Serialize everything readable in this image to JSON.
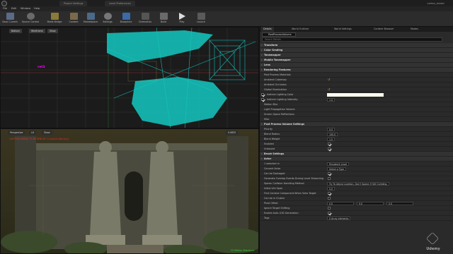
{
  "tabs": [
    {
      "label": "Project Settings"
    },
    {
      "label": "Level Preferences"
    }
  ],
  "project_name": "vertex_render",
  "menu": [
    "File",
    "Edit",
    "Window",
    "Help"
  ],
  "toolbar": [
    {
      "label": "Save Current",
      "icon": "save-icon"
    },
    {
      "label": "Source Control",
      "icon": "source-control-icon"
    },
    {
      "label": "Mode Bridge",
      "icon": "modes-icon"
    },
    {
      "label": "Content",
      "icon": "content-icon"
    },
    {
      "label": "Marketplace",
      "icon": "marketplace-icon"
    },
    {
      "label": "Settings",
      "icon": "settings-icon"
    },
    {
      "label": "Blueprints",
      "icon": "blueprints-icon"
    },
    {
      "label": "Cinematics",
      "icon": "cinematics-icon"
    },
    {
      "label": "Build",
      "icon": "build-icon"
    },
    {
      "label": "Play",
      "icon": "play-icon"
    },
    {
      "label": "Launch",
      "icon": "launch-icon"
    }
  ],
  "viewport_top": {
    "buttons": [
      "Bottom",
      "Wireframe",
      "Show"
    ],
    "marker_label": "ret3"
  },
  "viewport_persp": {
    "buttons": [
      "Perspective",
      "Lit",
      "Show"
    ],
    "zoom": "0.0625",
    "warning": "LIGHTING NEEDS TO BE REBUILT (1 unbuilt object(s))",
    "footer": "CG Motion Sequence"
  },
  "right_tabs": [
    "Details",
    "World Outliner",
    "World Settings",
    "Content Browser",
    "Modes"
  ],
  "actor_name": "PostProcessVolume",
  "search_placeholder": "Search Details",
  "rows": [
    {
      "kind": "section",
      "label": "Transform"
    },
    {
      "kind": "section",
      "label": "Color Grading"
    },
    {
      "kind": "section",
      "label": "Tonemapper"
    },
    {
      "kind": "section",
      "label": "Mobile Tonemapper"
    },
    {
      "kind": "section",
      "label": "Lens"
    },
    {
      "kind": "section",
      "label": "Rendering Features"
    },
    {
      "kind": "prop",
      "label": "Post Process Materials"
    },
    {
      "kind": "prop",
      "label": "Ambient Cubemap",
      "reset": true
    },
    {
      "kind": "prop",
      "label": "Ambient Occlusion"
    },
    {
      "kind": "prop",
      "label": "Global Illumination",
      "reset": true
    },
    {
      "kind": "sub",
      "label": "Indirect Lighting Color",
      "checked": true,
      "swatch": "#ffffee"
    },
    {
      "kind": "sub",
      "label": "Indirect Lighting Intensity",
      "checked": true,
      "value": "1.0"
    },
    {
      "kind": "prop",
      "label": "Motion Blur"
    },
    {
      "kind": "prop",
      "label": "Light Propagation Volume"
    },
    {
      "kind": "prop",
      "label": "Screen Space Reflections"
    },
    {
      "kind": "prop",
      "label": "Misc"
    },
    {
      "kind": "section",
      "label": "Post Process Volume Settings"
    },
    {
      "kind": "prop",
      "label": "Priority",
      "value": "0.0"
    },
    {
      "kind": "prop",
      "label": "Blend Radius",
      "value": "100.0"
    },
    {
      "kind": "prop",
      "label": "Blend Weight",
      "value": "1.0"
    },
    {
      "kind": "prop",
      "label": "Enabled",
      "check": true
    },
    {
      "kind": "prop",
      "label": "Unbound",
      "check": true
    },
    {
      "kind": "section",
      "label": "Brush Settings"
    },
    {
      "kind": "section",
      "label": "Actor"
    },
    {
      "kind": "prop",
      "label": "1 selected in",
      "value": "Persistent Level"
    },
    {
      "kind": "prop",
      "label": "Convert Actor",
      "value": "Select a Type"
    },
    {
      "kind": "prop",
      "label": "Can be Damaged",
      "check": true
    },
    {
      "kind": "prop",
      "label": "Generate Overlap Events During Level Streaming",
      "check": false
    },
    {
      "kind": "prop",
      "label": "Spawn Collision Handling Method",
      "value": "Try To Adjust Location, Don't Spawn If Still Colliding"
    },
    {
      "kind": "prop",
      "label": "Initial Life Span",
      "value": "0.0"
    },
    {
      "kind": "prop",
      "label": "Find Camera Component When View Target",
      "check": true
    },
    {
      "kind": "prop",
      "label": "Can be in Cluster",
      "check": false
    },
    {
      "kind": "prop",
      "label": "Pivot Offset",
      "vec": [
        "0.0",
        "0.0",
        "0.0"
      ]
    },
    {
      "kind": "prop",
      "label": "Ignore Target Shifting",
      "check": false
    },
    {
      "kind": "prop",
      "label": "Enable Auto LOD Generation",
      "check": true
    },
    {
      "kind": "prop",
      "label": "Tags",
      "value": "0 Array elements"
    }
  ],
  "watermark": "Udemy",
  "colors": {
    "wireframe": "#14c7c0",
    "accent": "#d8a000",
    "selection": "#ff00ff"
  }
}
